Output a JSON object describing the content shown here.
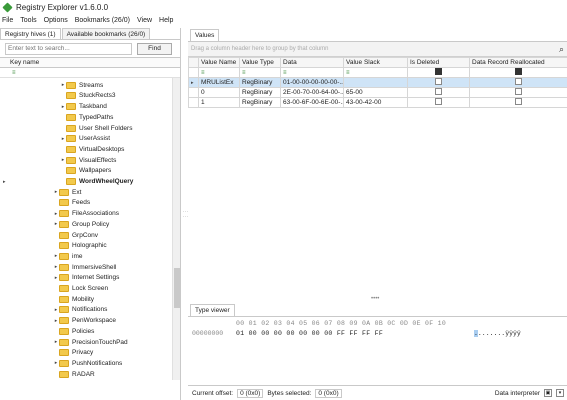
{
  "window": {
    "title": "Registry Explorer v1.6.0.0"
  },
  "menu": {
    "items": [
      "File",
      "Tools",
      "Options",
      "Bookmarks (26/0)",
      "View",
      "Help"
    ]
  },
  "left": {
    "tabs": [
      "Registry hives (1)",
      "Available bookmarks (26/0)"
    ],
    "search_placeholder": "Enter text to search...",
    "find_label": "Find",
    "column_header": "Key name",
    "filter_glyph": "≡"
  },
  "tree": [
    {
      "label": "Streams",
      "exp": "▸",
      "indent": 60
    },
    {
      "label": "StuckRects3",
      "exp": "",
      "indent": 60
    },
    {
      "label": "Taskband",
      "exp": "▸",
      "indent": 60
    },
    {
      "label": "TypedPaths",
      "exp": "",
      "indent": 60
    },
    {
      "label": "User Shell Folders",
      "exp": "",
      "indent": 60
    },
    {
      "label": "UserAssist",
      "exp": "▸",
      "indent": 60
    },
    {
      "label": "VirtualDesktops",
      "exp": "",
      "indent": 60
    },
    {
      "label": "VisualEffects",
      "exp": "▸",
      "indent": 60
    },
    {
      "label": "Wallpapers",
      "exp": "",
      "indent": 60
    },
    {
      "label": "WordWheelQuery",
      "exp": "",
      "indent": 60,
      "bold": true,
      "marker": "▸"
    },
    {
      "label": "Ext",
      "exp": "▸",
      "indent": 53
    },
    {
      "label": "Feeds",
      "exp": "",
      "indent": 53
    },
    {
      "label": "FileAssociations",
      "exp": "▸",
      "indent": 53
    },
    {
      "label": "Group Policy",
      "exp": "▸",
      "indent": 53
    },
    {
      "label": "GrpConv",
      "exp": "",
      "indent": 53
    },
    {
      "label": "Holographic",
      "exp": "",
      "indent": 53
    },
    {
      "label": "ime",
      "exp": "▸",
      "indent": 53
    },
    {
      "label": "ImmersiveShell",
      "exp": "▸",
      "indent": 53
    },
    {
      "label": "Internet Settings",
      "exp": "▸",
      "indent": 53
    },
    {
      "label": "Lock Screen",
      "exp": "",
      "indent": 53
    },
    {
      "label": "Mobility",
      "exp": "",
      "indent": 53
    },
    {
      "label": "Notifications",
      "exp": "▸",
      "indent": 53
    },
    {
      "label": "PenWorkspace",
      "exp": "▸",
      "indent": 53
    },
    {
      "label": "Policies",
      "exp": "",
      "indent": 53
    },
    {
      "label": "PrecisionTouchPad",
      "exp": "▸",
      "indent": 53
    },
    {
      "label": "Privacy",
      "exp": "",
      "indent": 53
    },
    {
      "label": "PushNotifications",
      "exp": "▸",
      "indent": 53
    },
    {
      "label": "RADAR",
      "exp": "",
      "indent": 53
    }
  ],
  "right": {
    "values_tab": "Values",
    "group_hint": "Drag a column header here to group by that column",
    "columns": [
      "Value Name",
      "Value Type",
      "Data",
      "Value Slack",
      "Is Deleted",
      "Data Record Reallocated"
    ],
    "filter_glyph": "≡",
    "rows": [
      {
        "name": "MRUListEx",
        "type": "RegBinary",
        "data": "01-00-00-00-00-00-...",
        "slack": "",
        "deleted": false,
        "realloc": false,
        "selected": true
      },
      {
        "name": "0",
        "type": "RegBinary",
        "data": "2E-00-70-00-64-00-...",
        "slack": "65-00",
        "deleted": false,
        "realloc": false
      },
      {
        "name": "1",
        "type": "RegBinary",
        "data": "63-00-6F-00-6E-00-...",
        "slack": "43-00-42-00",
        "deleted": false,
        "realloc": false
      }
    ],
    "grip": "••••"
  },
  "viewer": {
    "tab": "Type viewer",
    "hex_header": "00 01 02 03 04 05 06 07 08 09 0A 0B 0C 0D 0E 0F 10",
    "offset": "00000000",
    "bytes": "01 00 00 00 00 00 00 00 FF FF FF FF",
    "ascii_sel": ".",
    "ascii_rest": ".......ÿÿÿÿ"
  },
  "status": {
    "current_offset_label": "Current offset:",
    "current_offset": "0 (0x0)",
    "bytes_selected_label": "Bytes selected:",
    "bytes_selected": "0 (0x0)",
    "data_interpreter": "Data interpreter"
  }
}
